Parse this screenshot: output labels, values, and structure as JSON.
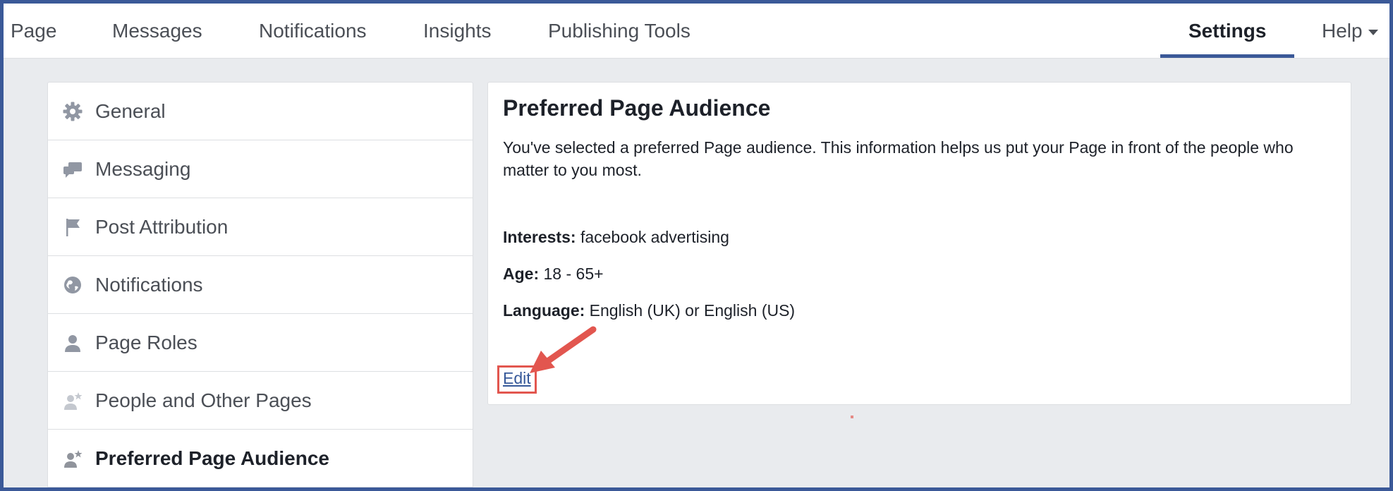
{
  "nav": {
    "items": [
      {
        "label": "Page"
      },
      {
        "label": "Messages"
      },
      {
        "label": "Notifications"
      },
      {
        "label": "Insights"
      },
      {
        "label": "Publishing Tools"
      }
    ],
    "settings_label": "Settings",
    "help_label": "Help"
  },
  "sidebar": {
    "items": [
      {
        "label": "General",
        "icon": "gear-icon"
      },
      {
        "label": "Messaging",
        "icon": "chat-bubbles-icon"
      },
      {
        "label": "Post Attribution",
        "icon": "flag-icon"
      },
      {
        "label": "Notifications",
        "icon": "globe-icon"
      },
      {
        "label": "Page Roles",
        "icon": "person-icon"
      },
      {
        "label": "People and Other Pages",
        "icon": "person-star-icon"
      },
      {
        "label": "Preferred Page Audience",
        "icon": "person-star-icon",
        "active": true
      }
    ]
  },
  "panel": {
    "title": "Preferred Page Audience",
    "description": "You've selected a preferred Page audience. This information helps us put your Page in front of the people who matter to you most.",
    "interests_label": "Interests:",
    "interests_value": "facebook advertising",
    "age_label": "Age:",
    "age_value": "18 - 65+",
    "language_label": "Language:",
    "language_value": "English (UK) or English (US)",
    "edit_label": "Edit"
  },
  "colors": {
    "brand": "#3b5998",
    "link": "#365899",
    "highlight": "#e2564f",
    "background": "#e9ebee"
  }
}
